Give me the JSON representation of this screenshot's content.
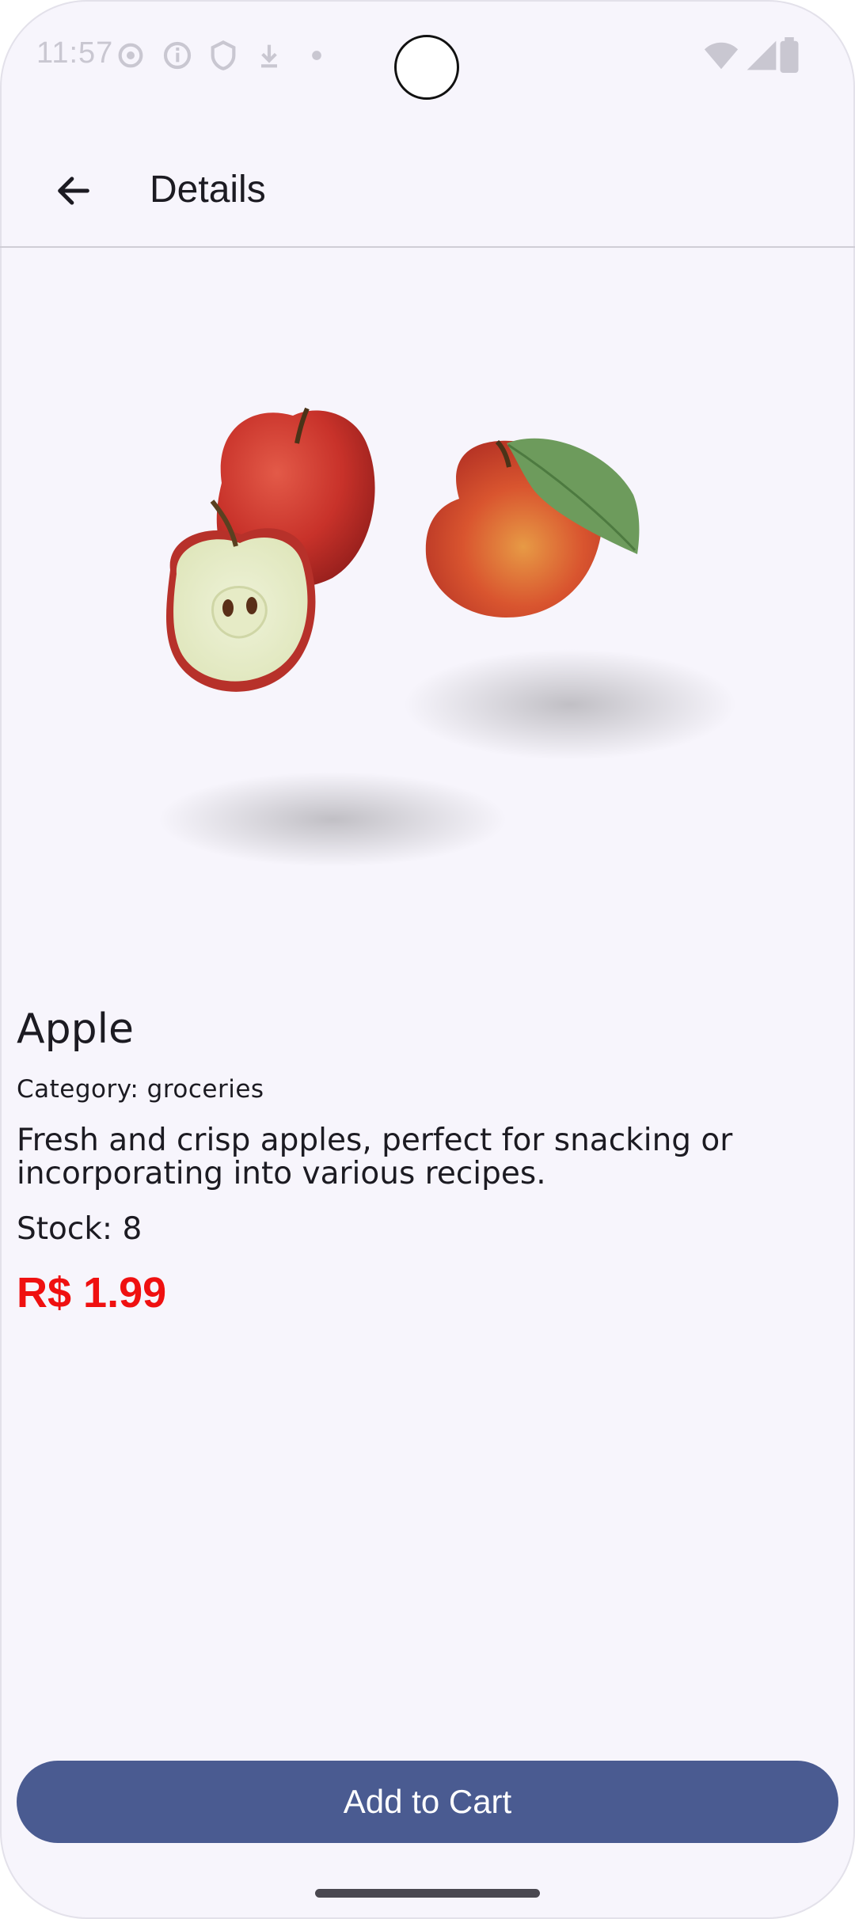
{
  "status_bar": {
    "time": "11:57",
    "left_icons": [
      "settings-icon",
      "info-icon",
      "shield-icon",
      "download-icon",
      "dot-icon"
    ],
    "right_icons": [
      "wifi-icon",
      "signal-icon",
      "battery-icon"
    ]
  },
  "app_bar": {
    "back_icon": "arrow-back-icon",
    "title": "Details"
  },
  "product": {
    "image": "apple-photo",
    "name": "Apple",
    "category": "Category: groceries",
    "description": "Fresh and crisp apples, perfect for snacking or incorporating into various recipes.",
    "stock": "Stock: 8",
    "price": "R$ 1.99",
    "price_color": "#ef1010"
  },
  "actions": {
    "add_to_cart": "Add to Cart",
    "button_color": "#4a5b91"
  }
}
